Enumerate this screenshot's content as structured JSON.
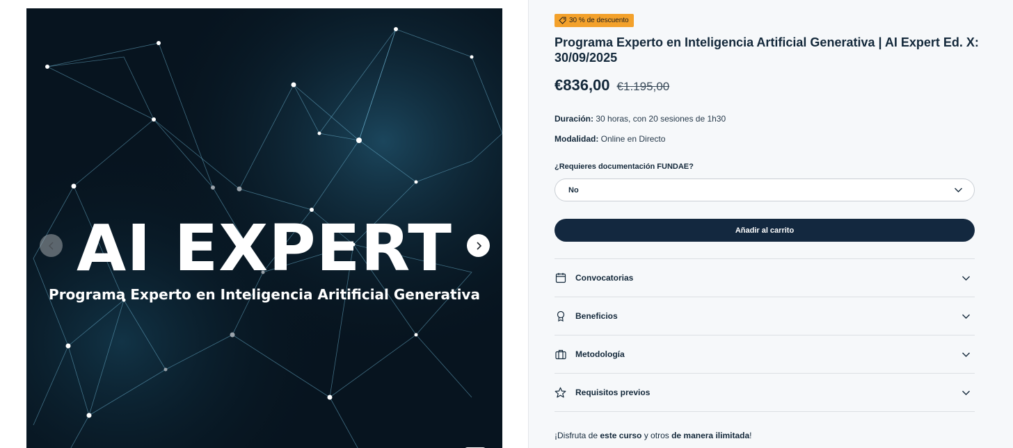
{
  "gallery": {
    "hero_title": "AI EXPERT",
    "hero_subtitle": "Programa Experto en Inteligencia Aritificial Generativa",
    "prev_icon": "chevron-left-icon",
    "next_icon": "chevron-right-icon"
  },
  "product": {
    "badge": "30 % de descuento",
    "badge_color": "#f3a12b",
    "title": "Programa Experto en Inteligencia Artificial Generativa | AI Expert Ed. X: 30/09/2025",
    "price": "€836,00",
    "old_price": "€1.195,00",
    "duration_label": "Duración:",
    "duration_value": " 30 horas, con 20 sesiones de 1h30",
    "mode_label": "Modalidad:",
    "mode_value": " Online en Directo",
    "fundae_label": "¿Requieres documentación FUNDAE?",
    "fundae_selected": "No",
    "add_to_cart": "Añadir al carrito",
    "accent_color": "#13283f"
  },
  "accordion": [
    {
      "label": "Convocatorias",
      "icon": "calendar-icon"
    },
    {
      "label": "Beneficios",
      "icon": "award-icon"
    },
    {
      "label": "Metodología",
      "icon": "briefcase-icon"
    },
    {
      "label": "Requisitos previos",
      "icon": "star-icon"
    }
  ],
  "footer": {
    "part1": "¡Disfruta de ",
    "part2": "este curso",
    "part3": " y otros ",
    "part4": "de manera ilimitada",
    "part5": "!"
  }
}
